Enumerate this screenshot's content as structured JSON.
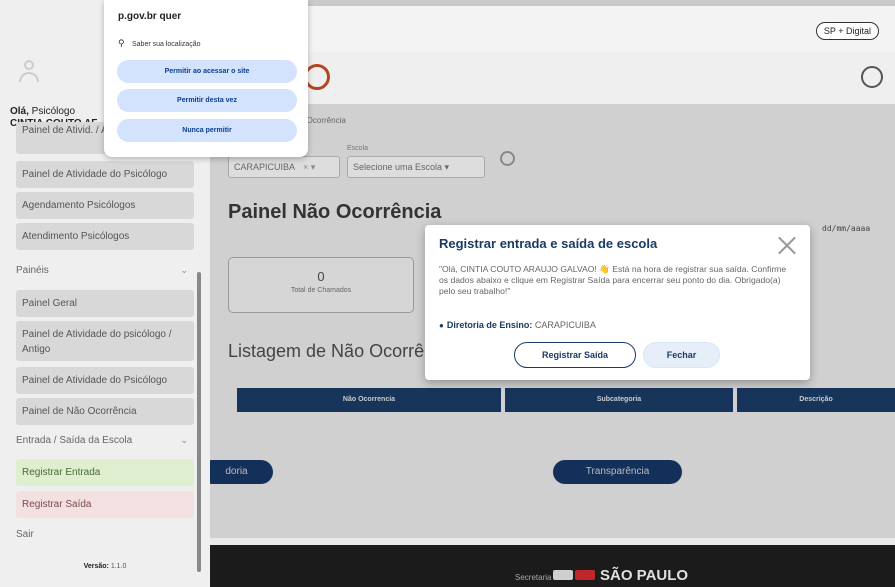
{
  "header": {
    "sp_digital": "SP + Digital"
  },
  "breadcrumb": "o Ocorrência",
  "filters": {
    "escola_label": "Escola",
    "diretoria_value": "CARAPICUIBA",
    "diretoria_arrows": "× ▾",
    "escola_placeholder": "Selecione uma Escola ▾"
  },
  "main": {
    "title": "Painel Não Ocorrência",
    "date_input": "dd/mm/aaaa",
    "stat_value": "0",
    "stat_label": "Total de Chamados",
    "listagem_title": "Listagem de Não Ocorrê",
    "table_headers": [
      "Não Ocorrencia",
      "Subcategoria",
      "Descrição"
    ],
    "ouvidoria_button": "doria",
    "transparencia_button": "Transparência"
  },
  "footer": {
    "secretaria": "Secretaria de",
    "sao_paulo": "SÃO PAULO"
  },
  "sidebar": {
    "greeting_bold": "Olá,",
    "greeting_role": " Psicólogo",
    "user_name": "CINTIA COUTO AF",
    "items_top": [
      "Painel de Ativid. / Antigo",
      "Painel de Atividade do Psicólogo",
      "Agendamento Psicólogos",
      "Atendimento Psicólogos"
    ],
    "section_paineis": "Painéis",
    "paineis_items": [
      "Painel Geral",
      "Painel de Atividade do psicólogo / Antigo",
      "Painel de Atividade do Psicólogo",
      "Painel de Não Ocorrência"
    ],
    "section_entrada": "Entrada / Saída da Escola",
    "registrar_entrada": "Registrar Entrada",
    "registrar_saida": "Registrar Saída",
    "sair": "Sair",
    "versao_label": "Versão:",
    "versao_value": " 1.1.0"
  },
  "permission_popup": {
    "title": "p.gov.br quer",
    "location_text": "Saber sua localização",
    "btn_allow_site": "Permitir ao acessar o site",
    "btn_allow_once": "Permitir desta vez",
    "btn_never": "Nunca permitir"
  },
  "modal": {
    "title": "Registrar entrada e saída de escola",
    "message": "\"Olá, CINTIA COUTO ARAUJO GALVAO! 👋 Está na hora de registrar sua saída. Confirme os dados abaixo e clique em Registrar Saída para encerrar seu ponto do dia. Obrigado(a) pelo seu trabalho!\"",
    "diretoria_label": "Diretoria de Ensino:",
    "diretoria_value": " CARAPICUIBA",
    "btn_registrar": "Registrar Saída",
    "btn_fechar": "Fechar"
  }
}
